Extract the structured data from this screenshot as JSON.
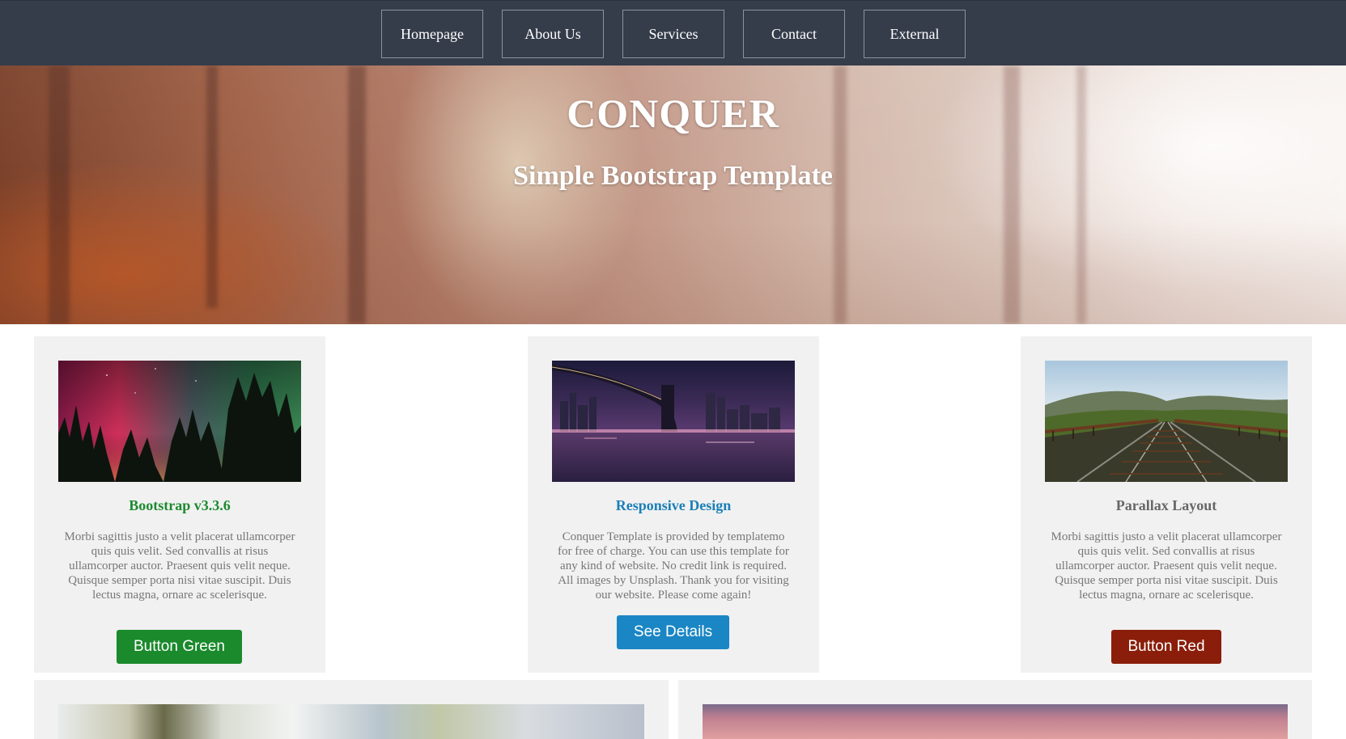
{
  "nav": {
    "items": [
      {
        "label": "Homepage"
      },
      {
        "label": "About Us"
      },
      {
        "label": "Services"
      },
      {
        "label": "Contact"
      },
      {
        "label": "External"
      }
    ]
  },
  "hero": {
    "title": "CONQUER",
    "subtitle": "Simple Bootstrap Template"
  },
  "cards": [
    {
      "title": "Bootstrap v3.3.6",
      "title_color": "#1d8b30",
      "text": "Morbi sagittis justo a velit placerat ullamcorper quis quis velit. Sed convallis at risus ullamcorper auctor. Praesent quis velit neque. Quisque semper porta nisi vitae suscipit. Duis lectus magna, ornare ac scelerisque.",
      "button_label": "Button Green",
      "button_color": "#1a8a2c"
    },
    {
      "title": "Responsive Design",
      "title_color": "#1a7fb8",
      "text": "Conquer Template is provided by templatemo for free of charge. You can use this template for any kind of website. No credit link is required. All images by Unsplash. Thank you for visiting our website. Please come again!",
      "button_label": "See Details",
      "button_color": "#1a86c4"
    },
    {
      "title": "Parallax Layout",
      "title_color": "#666666",
      "text": "Morbi sagittis justo a velit placerat ullamcorper quis quis velit. Sed convallis at risus ullamcorper auctor. Praesent quis velit neque. Quisque semper porta nisi vitae suscipit. Duis lectus magna, ornare ac scelerisque.",
      "button_label": "Button Red",
      "button_color": "#8a1e0a"
    }
  ]
}
